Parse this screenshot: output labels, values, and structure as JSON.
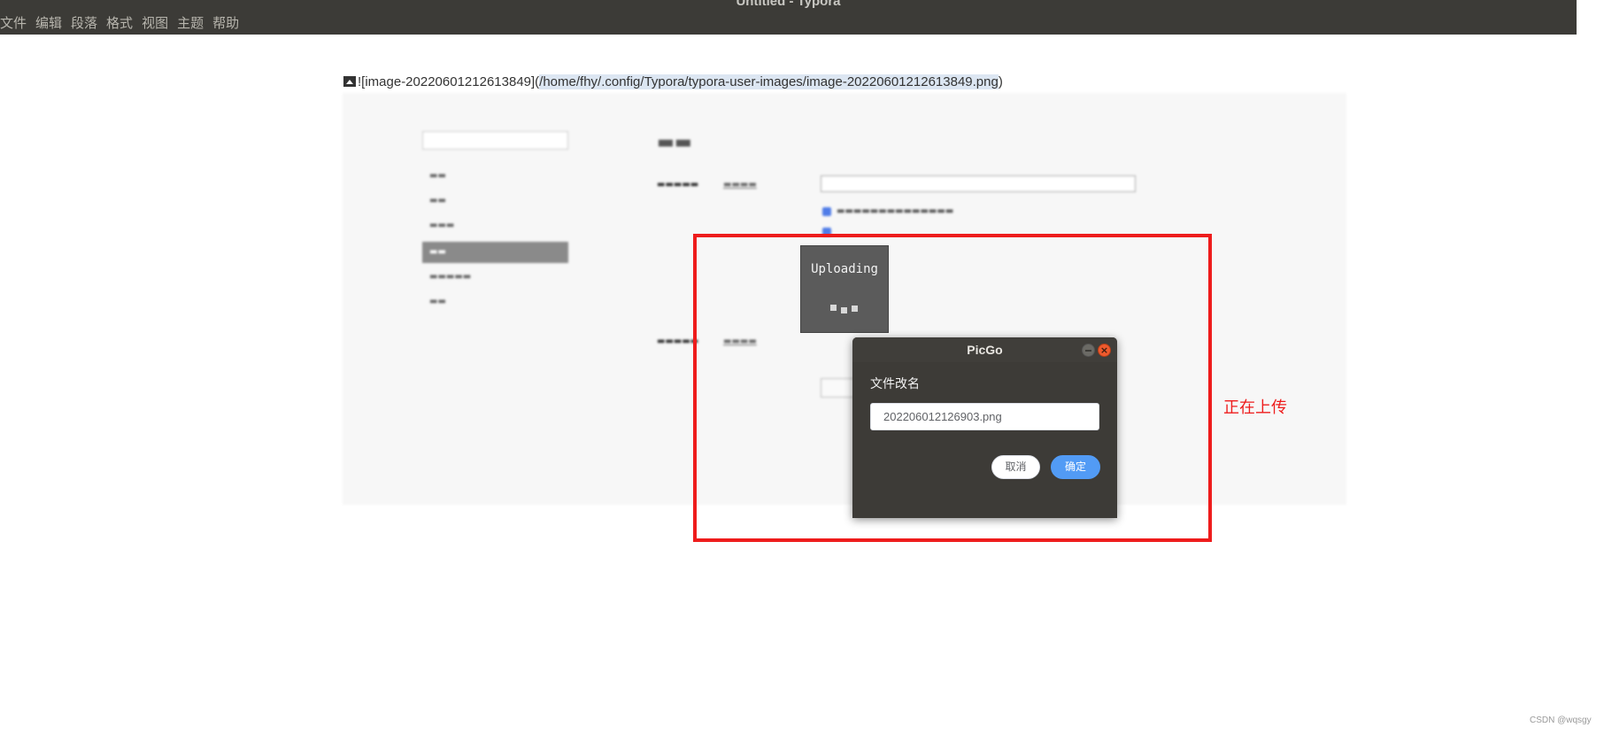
{
  "window": {
    "title": "Untitled - Typora"
  },
  "menubar": {
    "items": [
      "文件",
      "编辑",
      "段落",
      "格式",
      "视图",
      "主题",
      "帮助"
    ]
  },
  "editor": {
    "md_prefix": "![image-20220601212613849](",
    "md_path": "/home/fhy/.config/Typora/typora-user-images/image-20220601212613849.png",
    "md_suffix": ")"
  },
  "uploading": {
    "label": "Uploading"
  },
  "picgo": {
    "title": "PicGo",
    "close_symbol": "×",
    "field_label": "文件改名",
    "filename_value": "202206012126903.png",
    "cancel_label": "取消",
    "ok_label": "确定"
  },
  "annotation": {
    "text": "正在上传",
    "color": "#ee1c1c"
  },
  "watermark": {
    "text": "CSDN @wqsgy"
  },
  "colors": {
    "titlebar": "#3c3b37",
    "primary_button": "#529bf5",
    "highlight": "#ee1c1c"
  }
}
